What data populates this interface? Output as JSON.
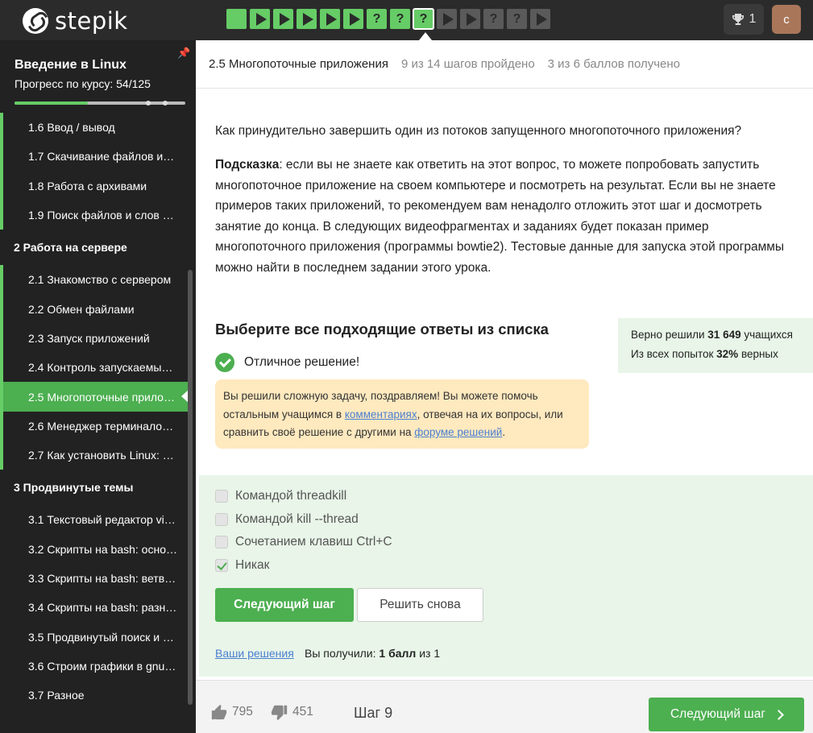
{
  "brand": {
    "name": "stepik"
  },
  "steps": [
    {
      "kind": "square",
      "color": "green"
    },
    {
      "kind": "play",
      "color": "green"
    },
    {
      "kind": "play",
      "color": "green"
    },
    {
      "kind": "play",
      "color": "green"
    },
    {
      "kind": "play",
      "color": "green"
    },
    {
      "kind": "play",
      "color": "green"
    },
    {
      "kind": "quiz",
      "color": "green",
      "label": "?"
    },
    {
      "kind": "quiz",
      "color": "green",
      "label": "?"
    },
    {
      "kind": "quiz",
      "color": "green",
      "label": "?",
      "current": true
    },
    {
      "kind": "play",
      "color": "gray"
    },
    {
      "kind": "play",
      "color": "gray"
    },
    {
      "kind": "quiz",
      "color": "gray",
      "label": "?"
    },
    {
      "kind": "quiz",
      "color": "gray",
      "label": "?"
    },
    {
      "kind": "play",
      "color": "gray"
    }
  ],
  "header": {
    "trophy_count": "1",
    "avatar_letter": "с"
  },
  "sidebar": {
    "course_title": "Введение в Linux",
    "progress_text": "Прогресс по курсу:  54/125",
    "progress_fraction": 0.43,
    "lessons": [
      {
        "type": "lesson",
        "label": "1.6  Ввод / вывод"
      },
      {
        "type": "lesson",
        "label": "1.7  Скачивание файлов и…"
      },
      {
        "type": "lesson",
        "label": "1.8  Работа с архивами"
      },
      {
        "type": "lesson",
        "label": "1.9  Поиск файлов и слов …"
      },
      {
        "type": "section",
        "label": "2  Работа на сервере"
      },
      {
        "type": "lesson",
        "label": "2.1  Знакомство с сервером"
      },
      {
        "type": "lesson",
        "label": "2.2  Обмен файлами"
      },
      {
        "type": "lesson",
        "label": "2.3  Запуск приложений"
      },
      {
        "type": "lesson",
        "label": "2.4  Контроль запускаемы…"
      },
      {
        "type": "lesson",
        "label": "2.5  Многопоточные прило…",
        "active": true
      },
      {
        "type": "lesson",
        "label": "2.6  Менеджер терминало…"
      },
      {
        "type": "lesson",
        "label": "2.7  Как установить Linux: …"
      },
      {
        "type": "section",
        "label": "3  Продвинутые темы"
      },
      {
        "type": "lesson",
        "label": "3.1  Текстовый редактор vi…",
        "nobar": true
      },
      {
        "type": "lesson",
        "label": "3.2  Скрипты на bash: осно…",
        "nobar": true
      },
      {
        "type": "lesson",
        "label": "3.3  Скрипты на bash: ветв…",
        "nobar": true
      },
      {
        "type": "lesson",
        "label": "3.4  Скрипты на bash: разн…",
        "nobar": true
      },
      {
        "type": "lesson",
        "label": "3.5  Продвинутый поиск и …",
        "nobar": true
      },
      {
        "type": "lesson",
        "label": "3.6  Строим графики в gnu…",
        "nobar": true
      },
      {
        "type": "lesson",
        "label": "3.7  Разное",
        "nobar": true
      }
    ]
  },
  "lesson_header": {
    "title": "2.5 Многопоточные приложения",
    "steps_done": "9 из 14 шагов пройдено",
    "points": "3 из 6 баллов  получено"
  },
  "question": "Как принудительно завершить один из потоков запущенного многопоточного приложения?",
  "hint": {
    "label": "Подсказка",
    "text": ": если вы не знаете как ответить на этот вопрос, то можете попробовать запустить многопоточное приложение на своем компьютере и посмотреть на результат. Если вы не знаете примеров таких приложений, то рекомендуем вам ненадолго отложить этот шаг и досмотреть занятие до конца. В следующих видеофрагментах и заданиях будет показан пример многопоточного приложения (программы bowtie2). Тестовые данные для запуска этой программы можно найти в последнем задании этого урока."
  },
  "choose_title": "Выберите все подходящие ответы из списка",
  "stats": {
    "solved_prefix": "Верно решили ",
    "solved_count": "31 649",
    "solved_suffix": " учащихся",
    "attempts_prefix": "Из всех попыток ",
    "attempts_percent": "32%",
    "attempts_suffix": " верных"
  },
  "success_text": "Отличное решение!",
  "notice": {
    "part1": "Вы решили сложную задачу, поздравляем! Вы можете помочь остальным учащимся в ",
    "link1": "комментариях",
    "part2": ", отвечая на их вопросы, или сравнить своё решение с другими на ",
    "link2": "форуме решений",
    "part3": "."
  },
  "options": [
    {
      "label": "Командой threadkill",
      "checked": false
    },
    {
      "label": "Командой kill --thread",
      "checked": false
    },
    {
      "label": "Сочетанием клавиш Ctrl+C",
      "checked": false
    },
    {
      "label": "Никак",
      "checked": true
    }
  ],
  "buttons": {
    "next_step": "Следующий шаг",
    "retry": "Решить снова"
  },
  "result": {
    "your_solutions": "Ваши решения",
    "score_prefix": "Вы получили: ",
    "score_value": "1 балл",
    "score_suffix": " из 1"
  },
  "footer": {
    "likes": "795",
    "dislikes": "451",
    "step_label": "Шаг 9",
    "next_label": "Следующий шаг"
  },
  "colors": {
    "accent": "#4caf50",
    "step_green": "#66cc66",
    "step_gray": "#5a5a5a",
    "notice_bg": "#ffe9bf",
    "answers_bg": "#e8f5e8"
  }
}
